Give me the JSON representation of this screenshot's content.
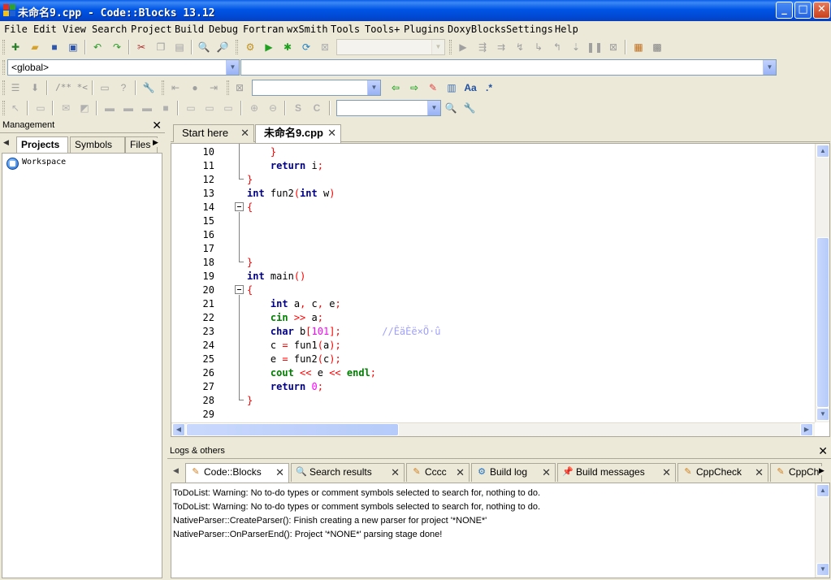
{
  "window": {
    "title": "未命名9.cpp - Code::Blocks 13.12",
    "buttons": {
      "minimize": "_",
      "maximize": "□",
      "close": "✕"
    }
  },
  "menu": [
    "File",
    "Edit",
    "View",
    "Search",
    "Project",
    "Build",
    "Debug",
    "Fortran",
    "wxSmith",
    "Tools",
    "Tools+",
    "Plugins",
    "DoxyBlocks",
    "Settings",
    "Help"
  ],
  "scope_combo": {
    "value": "<global>"
  },
  "management": {
    "title": "Management",
    "close": "✕",
    "tabs": [
      "Projects",
      "Symbols",
      "Files"
    ],
    "active_tab": "Projects",
    "tree": {
      "root": "Workspace"
    }
  },
  "editor": {
    "tabs": [
      {
        "label": "Start here",
        "close": "✕"
      },
      {
        "label": "未命名9.cpp",
        "close": "✕",
        "active": true
      }
    ],
    "line_numbers": [
      "10",
      "11",
      "12",
      "13",
      "14",
      "15",
      "16",
      "17",
      "18",
      "19",
      "20",
      "21",
      "22",
      "23",
      "24",
      "25",
      "26",
      "27",
      "28",
      "29"
    ],
    "code_lines": [
      {
        "text": "    }"
      },
      {
        "text": "    return i;"
      },
      {
        "text": "}"
      },
      {
        "text": "int fun2(int w)"
      },
      {
        "text": "{"
      },
      {
        "text": ""
      },
      {
        "text": ""
      },
      {
        "text": ""
      },
      {
        "text": "}"
      },
      {
        "text": "int main()"
      },
      {
        "text": "{"
      },
      {
        "text": "    int a, c, e;"
      },
      {
        "text": "    cin >> a;"
      },
      {
        "text": "    char b[101];       //ÊäÈë×Ö·û"
      },
      {
        "text": "    c = fun1(a);"
      },
      {
        "text": "    e = fun2(c);"
      },
      {
        "text": "    cout << e << endl;"
      },
      {
        "text": "    return 0;"
      },
      {
        "text": "}"
      },
      {
        "text": ""
      }
    ]
  },
  "logs": {
    "title": "Logs & others",
    "close": "✕",
    "tabs": [
      {
        "label": "Code::Blocks",
        "icon": "pencil-icon",
        "active": true
      },
      {
        "label": "Search results",
        "icon": "magnifier-icon"
      },
      {
        "label": "Cccc",
        "icon": "pencil-icon"
      },
      {
        "label": "Build log",
        "icon": "gear-icon"
      },
      {
        "label": "Build messages",
        "icon": "pin-icon"
      },
      {
        "label": "CppCheck",
        "icon": "pencil-icon"
      },
      {
        "label": "CppCh",
        "icon": "pencil-icon"
      }
    ],
    "lines": [
      "ToDoList: Warning: No to-do types or comment symbols selected to search for, nothing to do.",
      "ToDoList: Warning: No to-do types or comment symbols selected to search for, nothing to do.",
      "NativeParser::CreateParser(): Finish creating a new parser for project '*NONE*'",
      "NativeParser::OnParserEnd(): Project '*NONE*' parsing stage done!"
    ]
  },
  "toolbar_text": {
    "doc_comment": "/** *<",
    "regex": ".*",
    "font": "Aa"
  },
  "colors": {
    "titlebar": "#0055e5",
    "keyword": "#00008b",
    "stream_keyword": "#008000",
    "operator": "#ff0000",
    "number": "#ff00ff",
    "comment": "#a0a0ff"
  }
}
